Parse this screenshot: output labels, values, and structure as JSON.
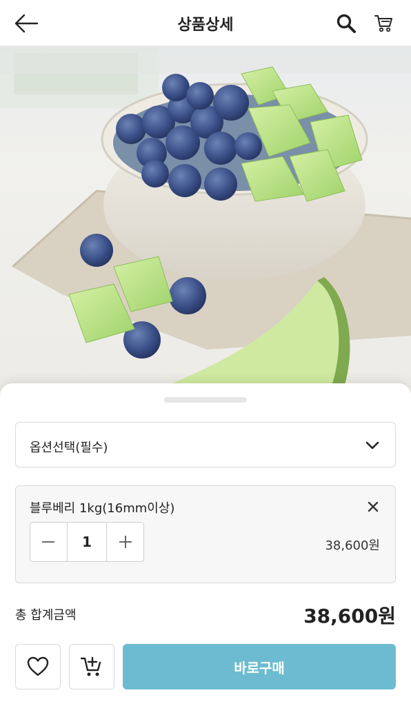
{
  "header": {
    "title": "상품상세",
    "back_icon": "arrow-left-icon",
    "search_icon": "search-icon",
    "cart_icon": "cart-icon"
  },
  "product_image": {
    "subject": "blueberries and melon cubes in a ceramic bowl"
  },
  "option_select": {
    "label": "옵션선택(필수)",
    "icon": "chevron-down-icon"
  },
  "selected_item": {
    "name": "블루베리 1kg(16mm이상)",
    "quantity": "1",
    "price": "38,600원",
    "remove_icon": "close-icon"
  },
  "total": {
    "label": "총 합계금액",
    "price": "38,600원"
  },
  "actions": {
    "wish_icon": "heart-icon",
    "add_cart_icon": "cart-plus-icon",
    "buy_label": "바로구매",
    "buy_color": "#6dbbd0"
  }
}
